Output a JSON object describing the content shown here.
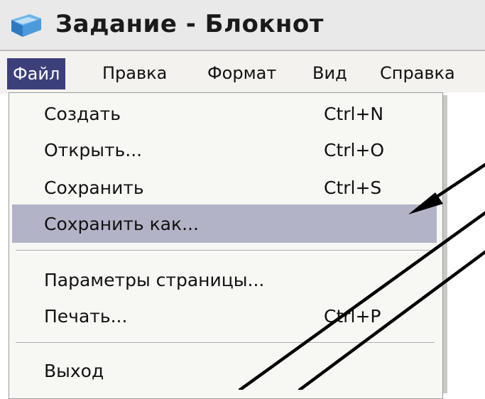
{
  "window": {
    "title": "Задание - Блокнот"
  },
  "menubar": {
    "items": [
      "Файл",
      "Правка",
      "Формат",
      "Вид",
      "Справка"
    ]
  },
  "file_menu": {
    "items": [
      {
        "label": "Создать",
        "shortcut": "Ctrl+N"
      },
      {
        "label": "Открыть...",
        "shortcut": "Ctrl+O"
      },
      {
        "label": "Сохранить",
        "shortcut": "Ctrl+S"
      },
      {
        "label": "Сохранить как...",
        "shortcut": ""
      },
      {
        "label": "Параметры страницы...",
        "shortcut": ""
      },
      {
        "label": "Печать...",
        "shortcut": "Ctrl+P"
      },
      {
        "label": "Выход",
        "shortcut": ""
      }
    ],
    "highlighted_item": "Сохранить как..."
  },
  "colors": {
    "menu_active": "#3b3f7a",
    "item_highlight": "#b3b3c7"
  },
  "icons": {
    "app_icon": "notepad-icon"
  }
}
